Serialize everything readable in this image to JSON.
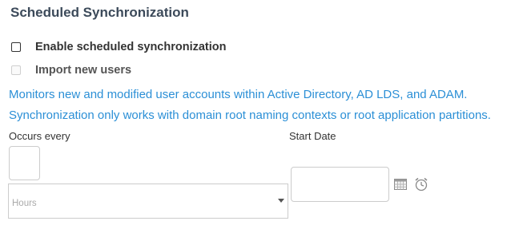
{
  "section": {
    "title": "Scheduled Synchronization"
  },
  "options": {
    "enable_scheduled": {
      "label": "Enable scheduled synchronization",
      "checked": false,
      "disabled": false
    },
    "import_new_users": {
      "label": "Import new users",
      "checked": false,
      "disabled": true
    }
  },
  "info": {
    "line1": "Monitors new and modified user accounts within Active Directory, AD LDS, and ADAM.",
    "line2": "Synchronization only works with domain root naming contexts or root application partitions."
  },
  "occurs_every": {
    "label": "Occurs every",
    "number_value": "",
    "unit_selected": "Hours"
  },
  "start_date": {
    "label": "Start Date",
    "value": "",
    "calendar_icon": "calendar-icon",
    "clock_icon": "clock-icon"
  },
  "colors": {
    "title": "#3c4a5a",
    "info_text": "#2b8fd6",
    "border": "#cccccc",
    "placeholder": "#aaaaaa"
  }
}
